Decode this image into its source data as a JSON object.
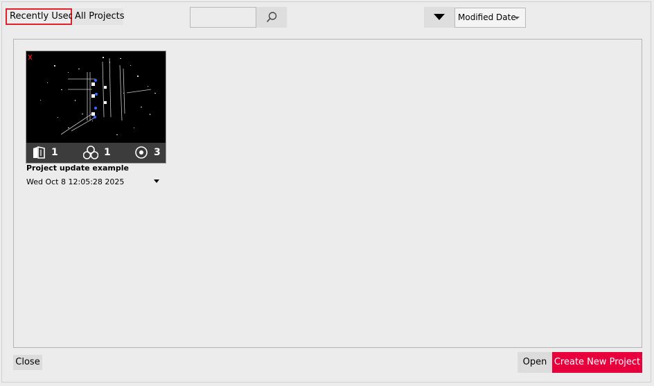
{
  "tabs": {
    "recent": "Recently Used",
    "all": "All Projects"
  },
  "search": {
    "value": "",
    "placeholder": ""
  },
  "sort": {
    "selected": "Modified Date"
  },
  "projects": [
    {
      "title": "Project update example",
      "modified": "Wed Oct 8 12:05:28 2025",
      "stats": {
        "maps": "1",
        "groups": "1",
        "scans": "3"
      }
    }
  ],
  "footer": {
    "close_label": "Close",
    "open_label": "Open",
    "create_label": "Create New Project"
  },
  "colors": {
    "accent": "#e8003c",
    "tab_highlight": "#e0202b"
  }
}
